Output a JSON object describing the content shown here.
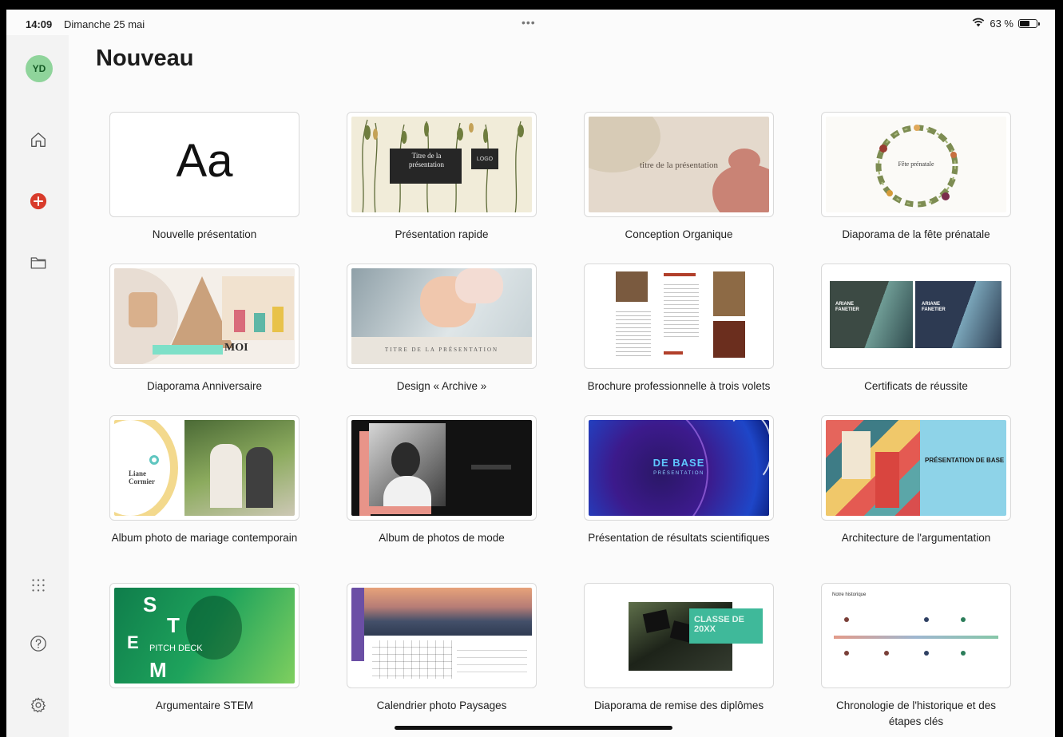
{
  "status_bar": {
    "time": "14:09",
    "date": "Dimanche 25 mai",
    "dots": "•••",
    "battery": "63 %",
    "battery_level": 0.63
  },
  "sidebar": {
    "avatar_initials": "YD",
    "icons": [
      "home-icon",
      "add-icon",
      "folder-icon",
      "apps-grid-icon",
      "help-icon",
      "settings-icon"
    ],
    "add_color": "#d83b2b"
  },
  "page": {
    "title": "Nouveau"
  },
  "templates": [
    {
      "label": "Nouvelle présentation",
      "thumb_text": "Aa"
    },
    {
      "label": "Présentation rapide",
      "thumb_text": "Titre de la présentation",
      "thumb_text_2": "LOGO"
    },
    {
      "label": "Conception Organique",
      "thumb_text": "titre de la présentation"
    },
    {
      "label": "Diaporama de la fête prénatale",
      "thumb_text": "Fête prénatale"
    },
    {
      "label": "Diaporama Anniversaire",
      "thumb_text": "MOI"
    },
    {
      "label": "Design « Archive »",
      "thumb_text": "TITRE DE LA PRÉSENTATION"
    },
    {
      "label": "Brochure professionnelle à trois volets",
      "thumb_text": ""
    },
    {
      "label": "Certificats de réussite",
      "thumb_text": "ARIANE FANETIER",
      "thumb_text_2": "ARIANE FANETIER"
    },
    {
      "label": "Album photo de mariage contemporain",
      "thumb_text": "Liane Cormier"
    },
    {
      "label": "Album de photos de mode",
      "thumb_text": ""
    },
    {
      "label": "Présentation de résultats scientifiques",
      "thumb_text": "DE BASE",
      "thumb_text_2": "PRÉSENTATION"
    },
    {
      "label": "Architecture de l'argumentation",
      "thumb_text": "PRÉSENTATION DE BASE"
    },
    {
      "label": "Argumentaire STEM",
      "thumb_text": "PITCH DECK"
    },
    {
      "label": "Calendrier photo Paysages",
      "thumb_text": ""
    },
    {
      "label": "Diaporama de remise des diplômes",
      "thumb_text": "CLASSE DE 20XX"
    },
    {
      "label": "Chronologie de l'historique et des étapes clés",
      "thumb_text": "Notre historique"
    }
  ]
}
